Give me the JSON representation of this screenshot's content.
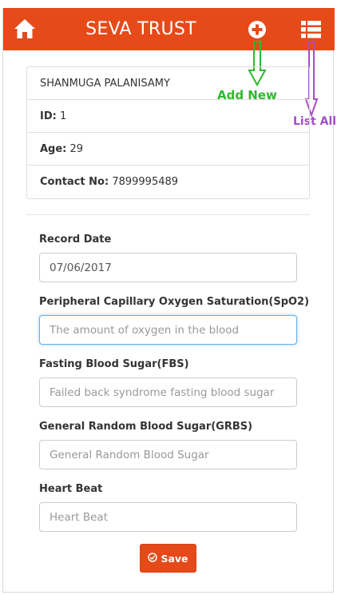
{
  "navbar": {
    "title": "SEVA TRUST",
    "home_icon": "home-icon",
    "add_icon": "plus-circle-icon",
    "list_icon": "list-icon",
    "color": "#e64a19"
  },
  "annotations": {
    "add_new": "Add New",
    "list_all": "List All",
    "add_color": "#2eb82e",
    "list_color": "#a64dc4"
  },
  "patient": {
    "name": "SHANMUGA PALANISAMY",
    "id_label": "ID:",
    "id_value": "1",
    "age_label": "Age:",
    "age_value": "29",
    "contact_label": "Contact No:",
    "contact_value": "7899995489"
  },
  "form": {
    "record_date": {
      "label": "Record Date",
      "value": "07/06/2017"
    },
    "spo2": {
      "label": "Peripheral Capillary Oxygen Saturation(SpO2)",
      "placeholder": "The amount of oxygen in the blood"
    },
    "fbs": {
      "label": "Fasting Blood Sugar(FBS)",
      "placeholder": "Failed back syndrome fasting blood sugar"
    },
    "grbs": {
      "label": "General Random Blood Sugar(GRBS)",
      "placeholder": "General Random Blood Sugar"
    },
    "heart_beat": {
      "label": "Heart Beat",
      "placeholder": "Heart Beat"
    },
    "save_label": "Save",
    "save_icon": "check-circle-icon"
  }
}
